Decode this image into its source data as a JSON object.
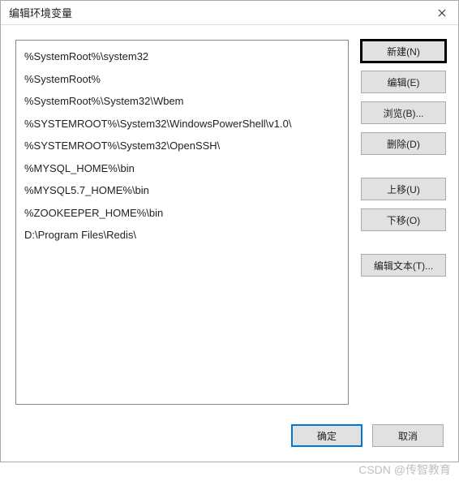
{
  "dialog": {
    "title": "编辑环境变量"
  },
  "list": {
    "items": [
      "%SystemRoot%\\system32",
      "%SystemRoot%",
      "%SystemRoot%\\System32\\Wbem",
      "%SYSTEMROOT%\\System32\\WindowsPowerShell\\v1.0\\",
      "%SYSTEMROOT%\\System32\\OpenSSH\\",
      "%MYSQL_HOME%\\bin",
      "%MYSQL5.7_HOME%\\bin",
      "%ZOOKEEPER_HOME%\\bin",
      "D:\\Program Files\\Redis\\"
    ]
  },
  "buttons": {
    "new": "新建(N)",
    "edit": "编辑(E)",
    "browse": "浏览(B)...",
    "delete": "删除(D)",
    "moveup": "上移(U)",
    "movedown": "下移(O)",
    "edittext": "编辑文本(T)...",
    "ok": "确定",
    "cancel": "取消"
  },
  "watermark": "CSDN @传智教育"
}
